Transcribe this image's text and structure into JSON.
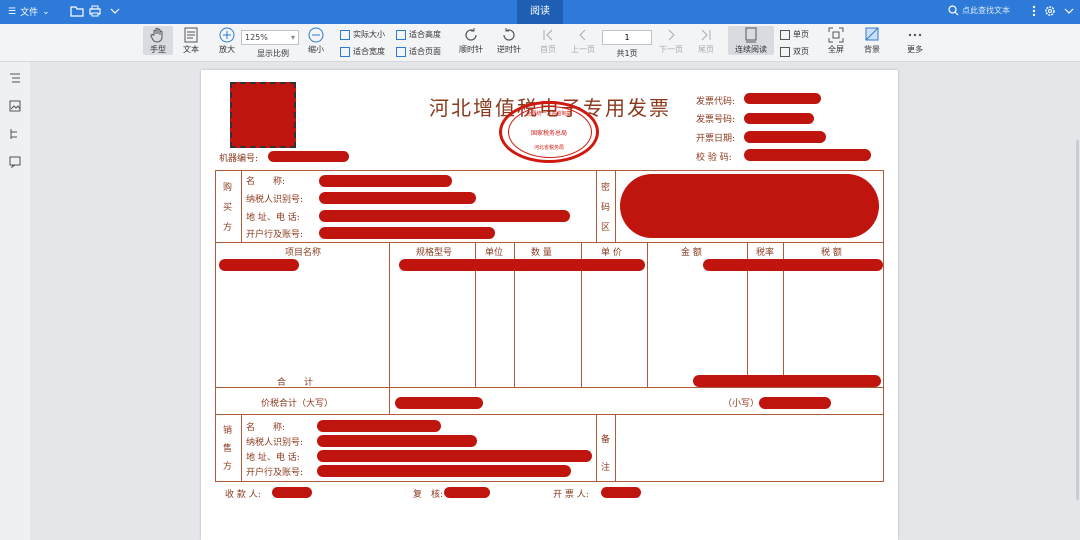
{
  "topbar": {
    "file_menu": "文件",
    "active_tab": "阅读",
    "search_placeholder": "点此查找文本"
  },
  "toolbar": {
    "hand": "手型",
    "text": "文本",
    "zoom_in": "放大",
    "zoom_value": "125%",
    "zoom_ratio": "显示比例",
    "zoom_out": "缩小",
    "actual_size": "实际大小",
    "fit_width": "适合宽度",
    "fit_height": "适合高度",
    "fit_page": "适合页面",
    "rotate_cw": "顺时针",
    "rotate_ccw": "逆时针",
    "first_page": "首页",
    "prev_page": "上一页",
    "page_value": "1",
    "total_pages": "共1页",
    "next_page": "下一页",
    "last_page": "尾页",
    "continuous": "连续阅读",
    "single": "单页",
    "double": "双页",
    "fullscreen": "全屏",
    "background": "背景",
    "more": "更多"
  },
  "invoice": {
    "title": "河北增值税电子专用发票",
    "seal_top": "全国统一发票监制章",
    "seal_mid": "国家税务总局",
    "seal_bottom": "河北省税务局",
    "right_labels": [
      "发票代码:",
      "发票号码:",
      "开票日期:",
      "校 验 码:"
    ],
    "machine_no": "机器编号:",
    "buyer_side": "购买方",
    "buyer_fields": [
      "名　　称:",
      "纳税人识别号:",
      "地 址、电 话:",
      "开户行及账号:"
    ],
    "cipher_side": "密码区",
    "cols": [
      "项目名称",
      "规格型号",
      "单位",
      "数 量",
      "单 价",
      "金 额",
      "税率",
      "税 额"
    ],
    "total": "合　　计",
    "amount_words": "价税合计（大写）",
    "amount_small": "（小写）",
    "seller_side": "销售方",
    "seller_fields": [
      "名　　称:",
      "纳税人识别号:",
      "地 址、电 话:",
      "开户行及账号:"
    ],
    "remark_side": "备注",
    "payee": "收 款 人:",
    "reviewer": "复　核:",
    "drawer": "开 票 人:"
  }
}
